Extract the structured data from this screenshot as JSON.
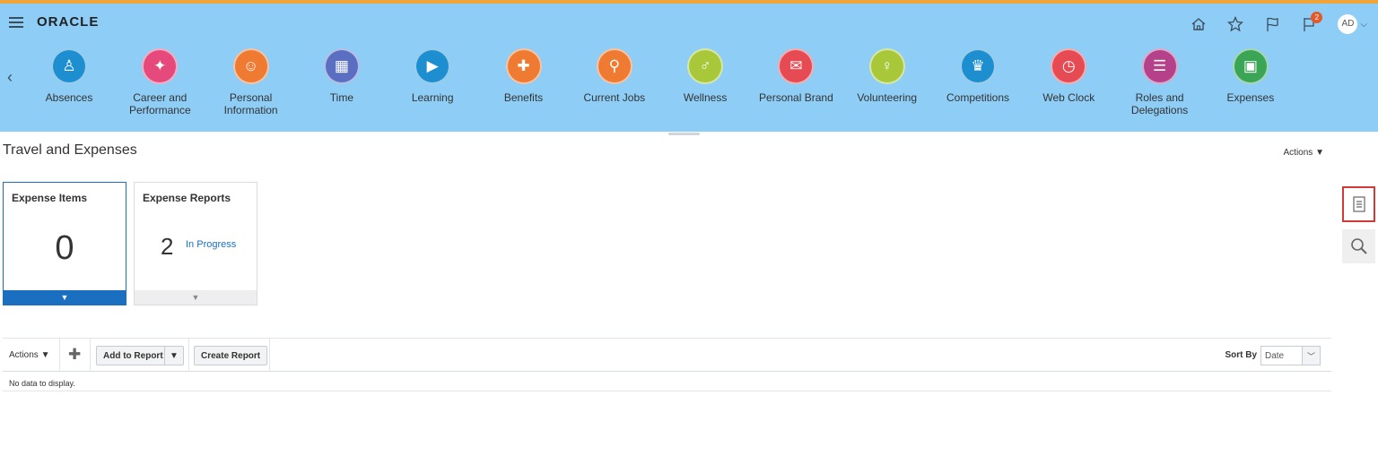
{
  "header": {
    "logo": "ORACLE",
    "notifications_count": "2",
    "avatar_initials": "AD",
    "colors": {
      "bar": "#8ecdf5",
      "accent_strip": "#f0a53a"
    }
  },
  "apps": [
    {
      "label_1": "Absences",
      "label_2": "",
      "color": "#1d8fd0",
      "glyph": "♙"
    },
    {
      "label_1": "Career and",
      "label_2": "Performance",
      "color": "#e64a7d",
      "glyph": "✦"
    },
    {
      "label_1": "Personal",
      "label_2": "Information",
      "color": "#ef7a32",
      "glyph": "☺"
    },
    {
      "label_1": "Time",
      "label_2": "",
      "color": "#5b6fc2",
      "glyph": "▦"
    },
    {
      "label_1": "Learning",
      "label_2": "",
      "color": "#1d8fd0",
      "glyph": "▶"
    },
    {
      "label_1": "Benefits",
      "label_2": "",
      "color": "#ef7a32",
      "glyph": "✚"
    },
    {
      "label_1": "Current Jobs",
      "label_2": "",
      "color": "#ef7a32",
      "glyph": "⚲"
    },
    {
      "label_1": "Wellness",
      "label_2": "",
      "color": "#a8c83a",
      "glyph": "♂"
    },
    {
      "label_1": "Personal Brand",
      "label_2": "",
      "color": "#e64a52",
      "glyph": "✉"
    },
    {
      "label_1": "Volunteering",
      "label_2": "",
      "color": "#a8c83a",
      "glyph": "♀"
    },
    {
      "label_1": "Competitions",
      "label_2": "",
      "color": "#1d8fd0",
      "glyph": "♛"
    },
    {
      "label_1": "Web Clock",
      "label_2": "",
      "color": "#e64a52",
      "glyph": "◷"
    },
    {
      "label_1": "Roles and",
      "label_2": "Delegations",
      "color": "#b5418a",
      "glyph": "☰"
    },
    {
      "label_1": "Expenses",
      "label_2": "",
      "color": "#3aa655",
      "glyph": "▣"
    }
  ],
  "page": {
    "title": "Travel and Expenses",
    "actions_label": "Actions"
  },
  "tiles": {
    "expense_items": {
      "title": "Expense Items",
      "count": "0"
    },
    "expense_reports": {
      "title": "Expense Reports",
      "count": "2",
      "status": "In Progress"
    }
  },
  "toolbar": {
    "actions_label": "Actions",
    "add_to_report": "Add to Report",
    "create_report": "Create Report",
    "sort_by_label": "Sort By",
    "sort_by_value": "Date"
  },
  "table": {
    "empty_text": "No data to display."
  }
}
